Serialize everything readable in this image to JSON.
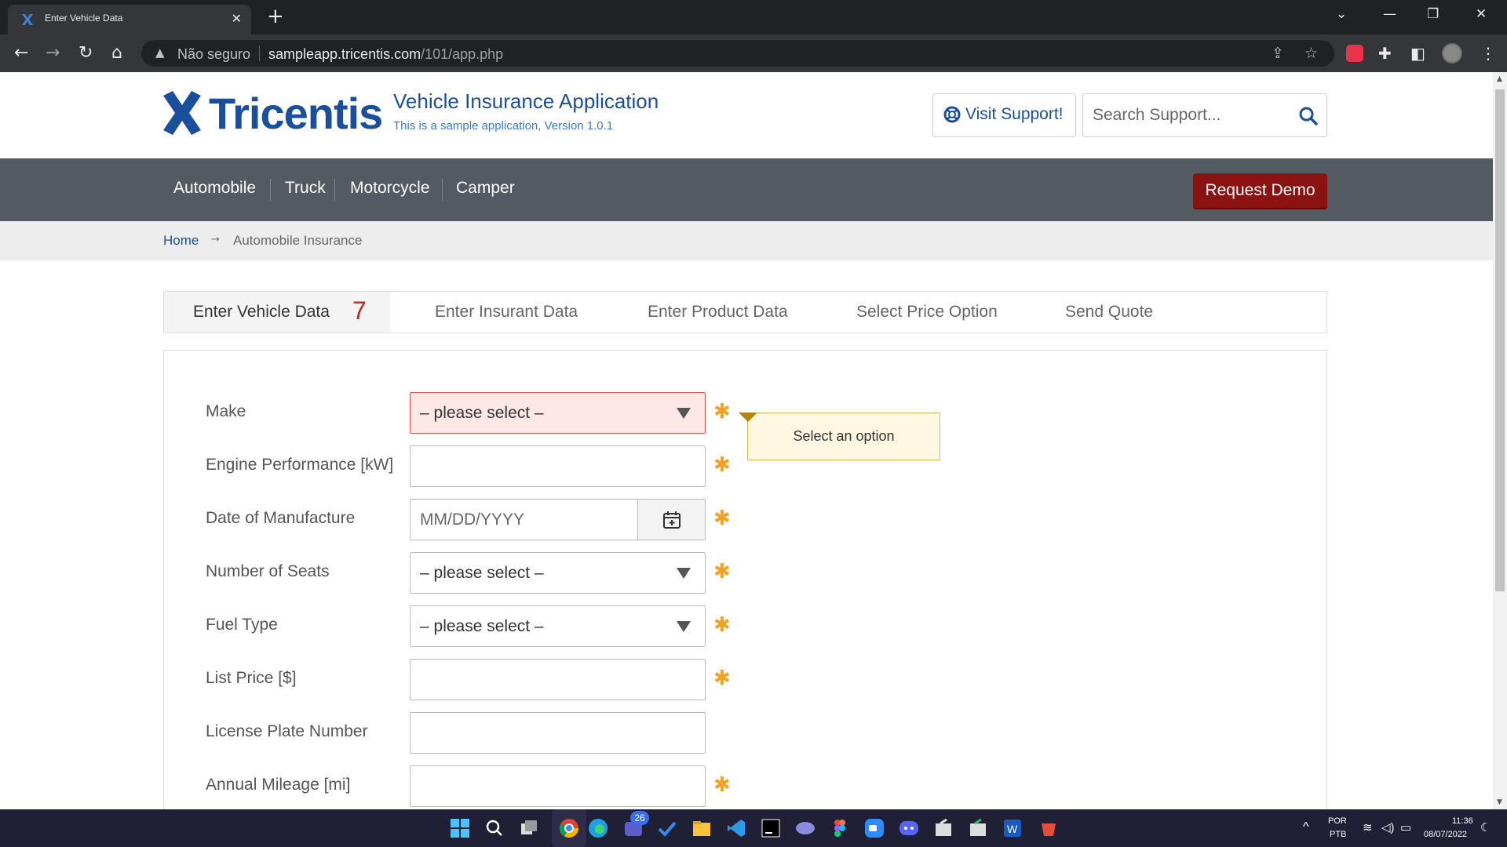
{
  "browser": {
    "tab_title": "Enter Vehicle Data",
    "security_label": "Não seguro",
    "url_host": "sampleapp.tricentis.com",
    "url_path": "/101/app.php"
  },
  "header": {
    "logo_text": "Tricentis",
    "app_title": "Vehicle Insurance Application",
    "app_subtitle": "This is a sample application, Version 1.0.1",
    "support_button": "Visit Support!",
    "search_placeholder": "Search Support..."
  },
  "nav": {
    "items": [
      "Automobile",
      "Truck",
      "Motorcycle",
      "Camper"
    ],
    "demo_button": "Request Demo"
  },
  "breadcrumb": {
    "home": "Home",
    "current": "Automobile Insurance"
  },
  "steps": {
    "items": [
      "Enter Vehicle Data",
      "Enter Insurant Data",
      "Enter Product Data",
      "Select Price Option",
      "Send Quote"
    ],
    "active_index": 0,
    "active_count": "7"
  },
  "form": {
    "make": {
      "label": "Make",
      "value": "– please select –"
    },
    "engine": {
      "label": "Engine Performance [kW]",
      "value": ""
    },
    "date": {
      "label": "Date of Manufacture",
      "placeholder": "MM/DD/YYYY"
    },
    "seats": {
      "label": "Number of Seats",
      "value": "– please select –"
    },
    "fuel": {
      "label": "Fuel Type",
      "value": "– please select –"
    },
    "price": {
      "label": "List Price [$]",
      "value": ""
    },
    "plate": {
      "label": "License Plate Number",
      "value": ""
    },
    "mileage": {
      "label": "Annual Mileage [mi]",
      "value": ""
    },
    "required_marker": "✱",
    "tooltip": "Select an option"
  },
  "taskbar": {
    "badge_count": "26",
    "lang_top": "POR",
    "lang_bottom": "PTB",
    "time": "11:36",
    "date": "08/07/2022"
  },
  "colors": {
    "brand_blue": "#1a4f9c",
    "nav_bg": "#535a62",
    "demo_red": "#8a1211",
    "required_orange": "#f0a328",
    "error_bg": "#fde7e7"
  }
}
